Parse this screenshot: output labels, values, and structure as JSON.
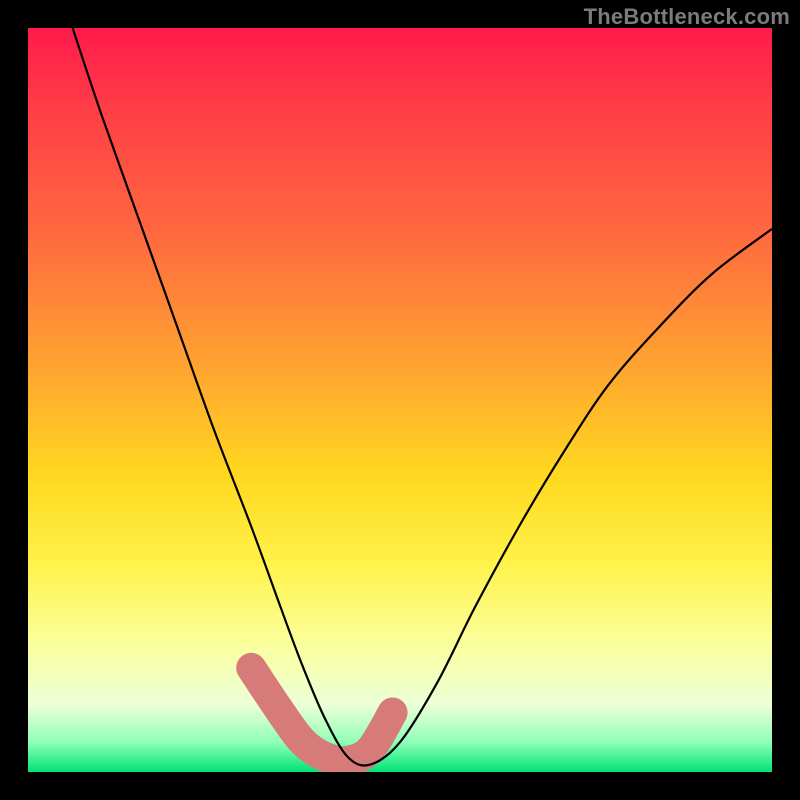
{
  "watermark": "TheBottleneck.com",
  "chart_data": {
    "type": "line",
    "title": "",
    "xlabel": "",
    "ylabel": "",
    "xlim": [
      0,
      100
    ],
    "ylim": [
      0,
      100
    ],
    "grid": false,
    "legend": false,
    "background_gradient": {
      "top": "#ff1a4b",
      "mid": "#ffe845",
      "bottom": "#00e477"
    },
    "series": [
      {
        "name": "bottleneck-curve",
        "color": "#000000",
        "stroke_width": 2,
        "x": [
          6,
          10,
          15,
          20,
          25,
          30,
          34,
          37,
          40,
          43,
          46,
          50,
          55,
          60,
          66,
          72,
          78,
          85,
          92,
          100
        ],
        "y": [
          100,
          88,
          74,
          60,
          46,
          33,
          22,
          14,
          7,
          2,
          1,
          4,
          12,
          22,
          33,
          43,
          52,
          60,
          67,
          73
        ]
      },
      {
        "name": "highlight-band",
        "color": "#d77b7a",
        "stroke_width": 14,
        "stroke_linecap": "round",
        "x": [
          30,
          34,
          37,
          40,
          43,
          46,
          49
        ],
        "y": [
          14,
          8,
          4,
          2,
          1.5,
          3,
          8
        ]
      }
    ],
    "annotations": []
  }
}
